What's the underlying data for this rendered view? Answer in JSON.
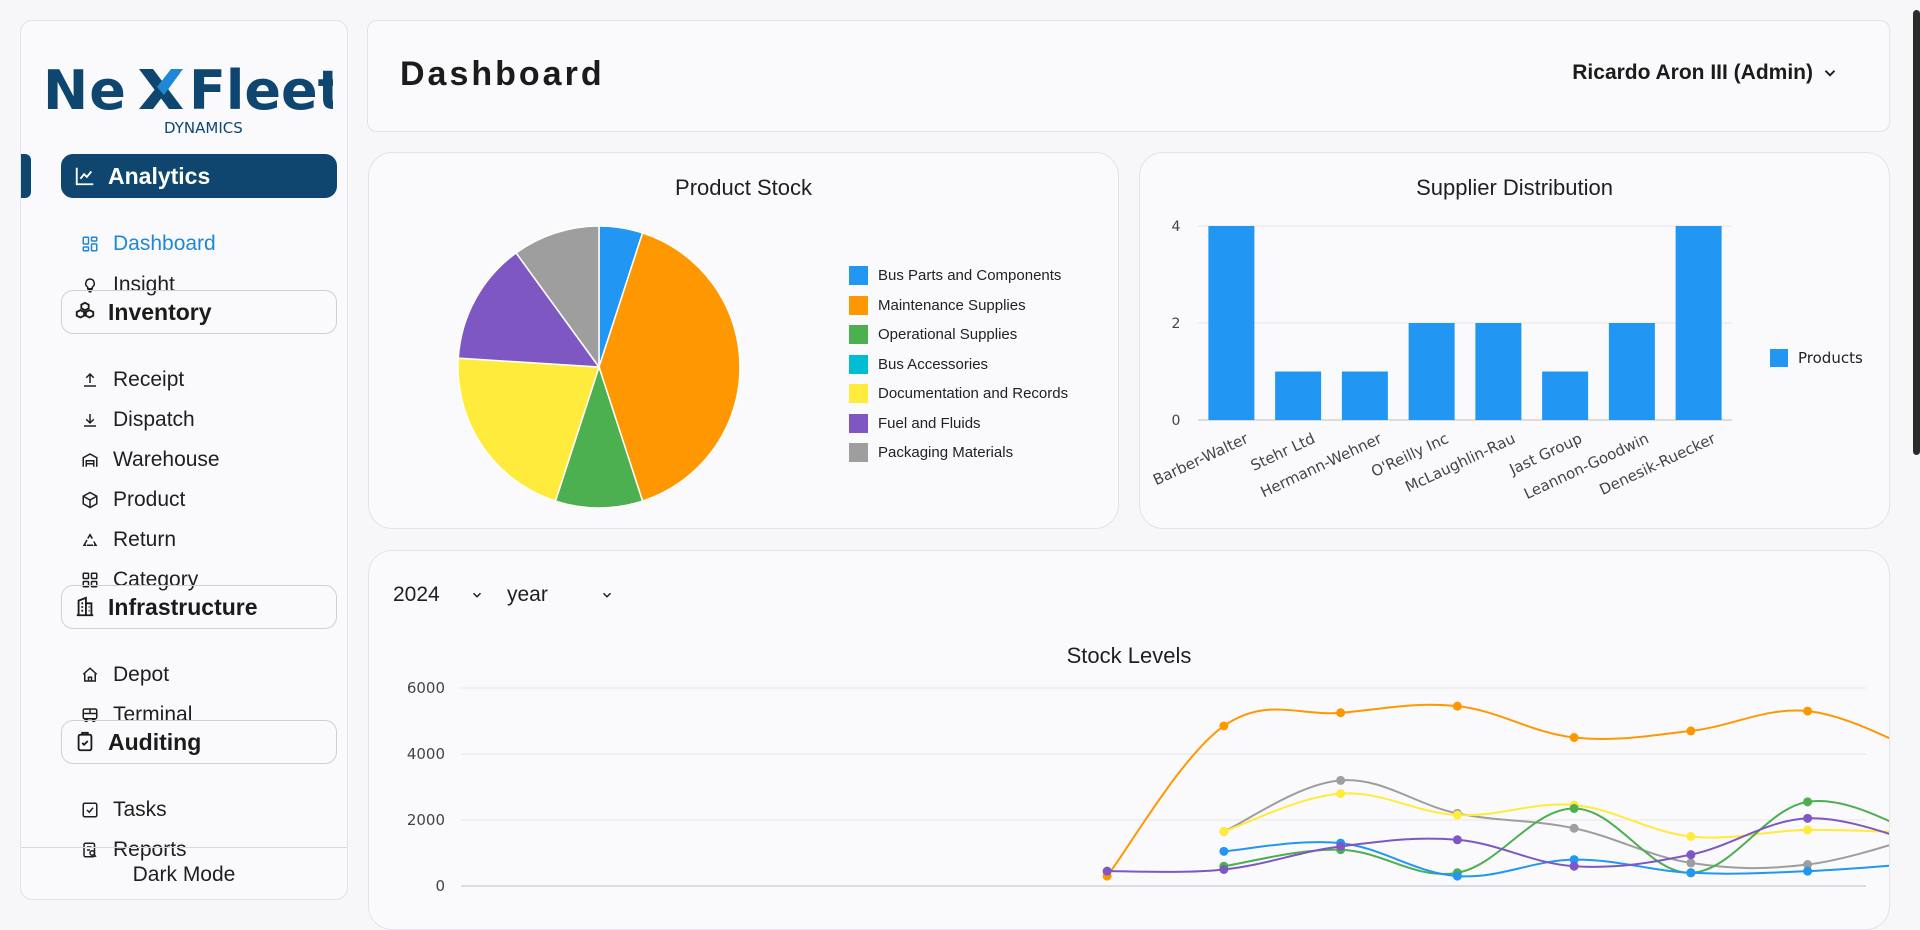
{
  "brand": {
    "name": "NexFleet",
    "tagline": "DYNAMICS",
    "color": "#0e4670"
  },
  "sidebar": {
    "sections": [
      {
        "label": "Analytics",
        "icon": "chart-icon",
        "active": true,
        "items": [
          {
            "label": "Dashboard",
            "icon": "grid-icon",
            "active": true
          },
          {
            "label": "Insight",
            "icon": "lightbulb-icon"
          }
        ]
      },
      {
        "label": "Inventory",
        "icon": "boxes-icon",
        "items": [
          {
            "label": "Receipt",
            "icon": "upload-icon"
          },
          {
            "label": "Dispatch",
            "icon": "download-icon"
          },
          {
            "label": "Warehouse",
            "icon": "warehouse-icon"
          },
          {
            "label": "Product",
            "icon": "package-icon"
          },
          {
            "label": "Return",
            "icon": "recycle-icon"
          },
          {
            "label": "Category",
            "icon": "category-icon"
          }
        ]
      },
      {
        "label": "Infrastructure",
        "icon": "building-icon",
        "items": [
          {
            "label": "Depot",
            "icon": "house-icon"
          },
          {
            "label": "Terminal",
            "icon": "bus-icon"
          }
        ]
      },
      {
        "label": "Auditing",
        "icon": "clipboard-icon",
        "items": [
          {
            "label": "Tasks",
            "icon": "checkbox-icon"
          },
          {
            "label": "Reports",
            "icon": "report-icon"
          }
        ]
      }
    ],
    "dark_mode_label": "Dark Mode"
  },
  "header": {
    "title": "Dashboard",
    "user": "Ricardo Aron III (Admin)"
  },
  "filters": {
    "year": "2024",
    "period": "year"
  },
  "colors": {
    "blue": "#2196f3",
    "orange": "#ff9800",
    "green": "#4caf50",
    "cyan": "#00bcd4",
    "yellow": "#ffeb3b",
    "purple": "#7e57c2",
    "gray": "#9e9e9e"
  },
  "chart_data": [
    {
      "type": "pie",
      "title": "Product Stock",
      "labels": [
        "Bus Parts and Components",
        "Maintenance Supplies",
        "Operational Supplies",
        "Bus Accessories",
        "Documentation and Records",
        "Fuel and Fluids",
        "Packaging Materials"
      ],
      "values": [
        5,
        40,
        10,
        0,
        21,
        14,
        10
      ],
      "colors": [
        "#2196f3",
        "#ff9800",
        "#4caf50",
        "#00bcd4",
        "#ffeb3b",
        "#7e57c2",
        "#9e9e9e"
      ],
      "legend": "right"
    },
    {
      "type": "bar",
      "title": "Supplier Distribution",
      "categories": [
        "Barber-Walter",
        "Stehr Ltd",
        "Hermann-Wehner",
        "O'Reilly Inc",
        "McLaughlin-Rau",
        "Jast Group",
        "Leannon-Goodwin",
        "Denesik-Ruecker"
      ],
      "series": [
        {
          "name": "Products",
          "values": [
            4,
            1,
            1,
            2,
            2,
            1,
            2,
            4
          ],
          "color": "#2196f3"
        }
      ],
      "yticks": [
        0,
        2,
        4
      ],
      "ylim": [
        0,
        4
      ],
      "legend": "right"
    },
    {
      "type": "line",
      "title": "Stock Levels",
      "yticks": [
        0,
        2000,
        4000,
        6000
      ],
      "ylim": [
        0,
        6000
      ],
      "slots": 12,
      "series": [
        {
          "color": "#ff9800",
          "start": 5,
          "values": [
            300,
            4850,
            5250,
            5450,
            4500,
            4700,
            5300,
            4000
          ]
        },
        {
          "color": "#9e9e9e",
          "start": 6,
          "values": [
            1650,
            3200,
            2200,
            1750,
            700,
            650,
            1550
          ]
        },
        {
          "color": "#ffeb3b",
          "start": 6,
          "values": [
            1650,
            2800,
            2150,
            2450,
            1500,
            1700,
            1600
          ]
        },
        {
          "color": "#4caf50",
          "start": 6,
          "values": [
            600,
            1100,
            400,
            2350,
            400,
            2550,
            1500
          ]
        },
        {
          "color": "#2196f3",
          "start": 6,
          "values": [
            1050,
            1300,
            300,
            800,
            400,
            450,
            700
          ]
        },
        {
          "color": "#7e57c2",
          "start": 5,
          "values": [
            450,
            500,
            1200,
            1400,
            600,
            950,
            2050,
            1250
          ]
        }
      ]
    }
  ]
}
